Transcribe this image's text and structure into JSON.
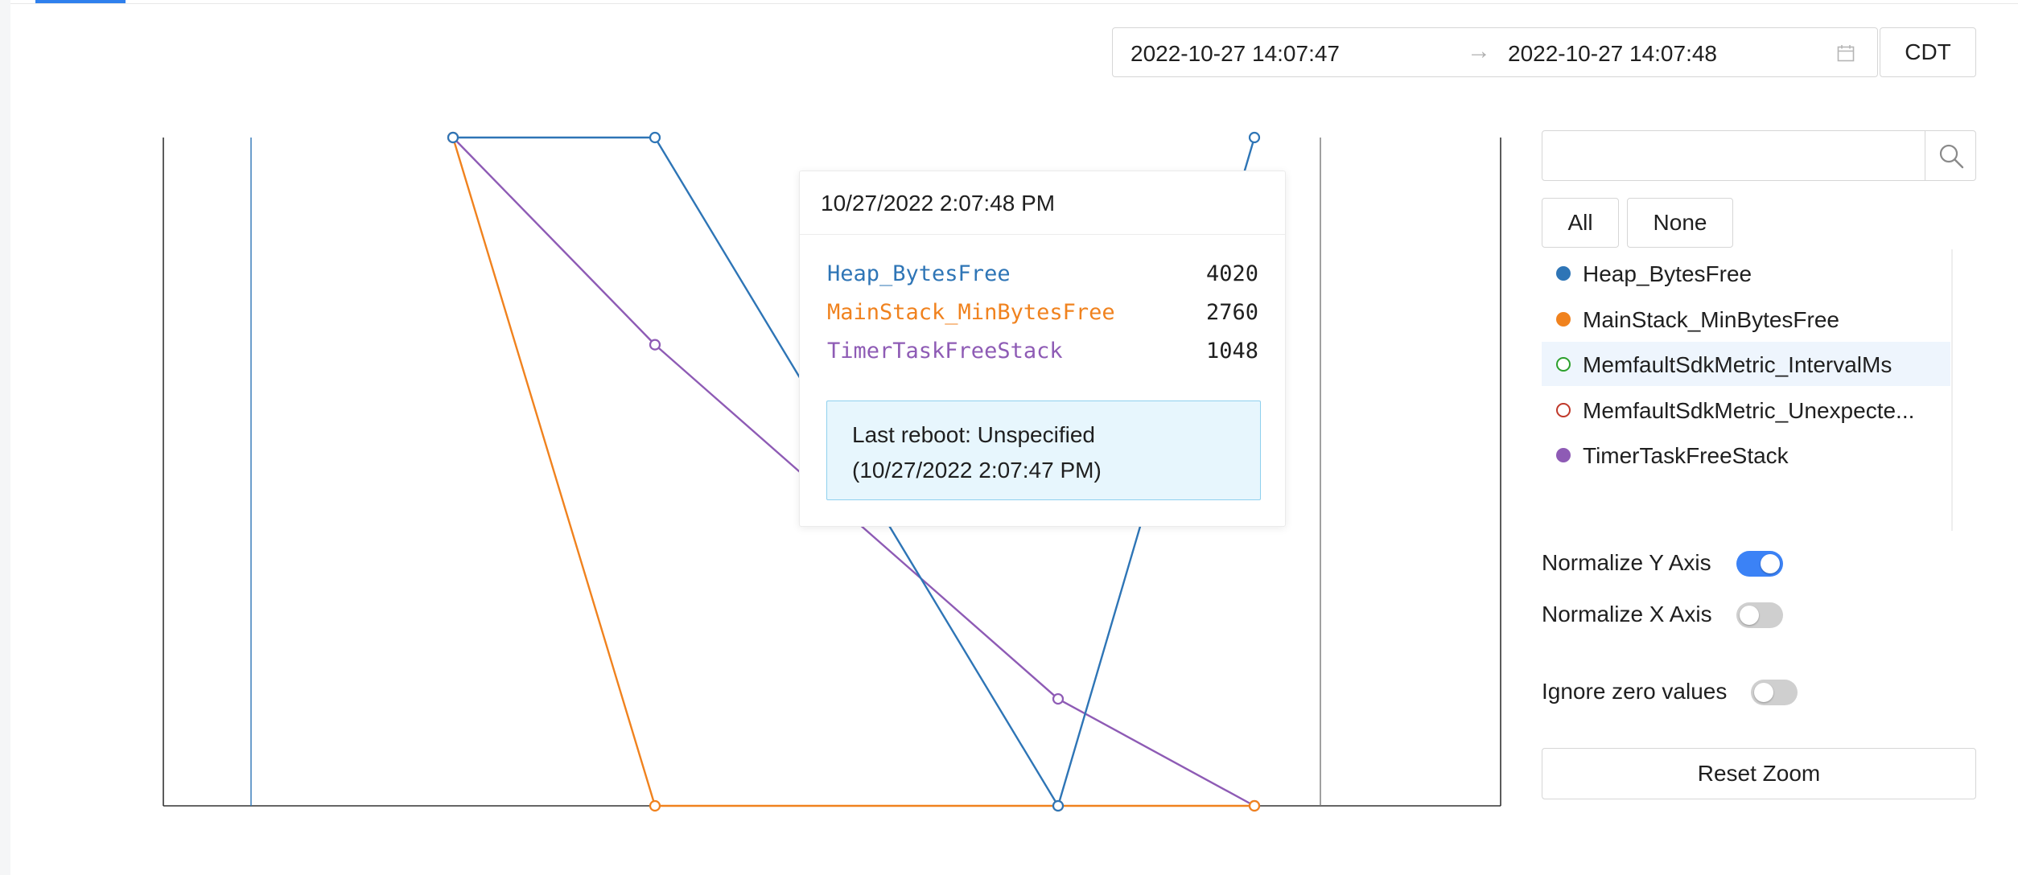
{
  "date_range": {
    "start": "2022-10-27 14:07:47",
    "end": "2022-10-27 14:07:48",
    "timezone": "CDT"
  },
  "chart_data": {
    "type": "line",
    "y_normalized": true,
    "series": [
      {
        "name": "Heap_BytesFree",
        "color": "#2e75b6",
        "values": [
          null,
          null,
          1.0,
          1.0,
          0.0,
          1.0
        ]
      },
      {
        "name": "MainStack_MinBytesFree",
        "color": "#f0821e",
        "values": [
          null,
          null,
          1.0,
          0.0,
          0.0,
          0.0
        ]
      },
      {
        "name": "TimerTaskFreeStack",
        "color": "#8e5bb5",
        "values": [
          null,
          null,
          1.0,
          0.69,
          0.16,
          0.0
        ]
      }
    ]
  },
  "tooltip": {
    "timestamp": "10/27/2022 2:07:48 PM",
    "rows": [
      {
        "name": "Heap_BytesFree",
        "value": "4020",
        "color": "#2e75b6"
      },
      {
        "name": "MainStack_MinBytesFree",
        "value": "2760",
        "color": "#f0821e"
      },
      {
        "name": "TimerTaskFreeStack",
        "value": "1048",
        "color": "#8e5bb5"
      }
    ],
    "reboot_line1": "Last reboot: Unspecified",
    "reboot_line2": "(10/27/2022 2:07:47 PM)"
  },
  "sidebar": {
    "search": {
      "placeholder": ""
    },
    "all_label": "All",
    "none_label": "None",
    "legend": [
      {
        "label": "Heap_BytesFree",
        "color": "#2e75b6",
        "enabled": true,
        "highlighted": false
      },
      {
        "label": "MainStack_MinBytesFree",
        "color": "#f0821e",
        "enabled": true,
        "highlighted": false
      },
      {
        "label": "MemfaultSdkMetric_IntervalMs",
        "color": "#2ca02c",
        "enabled": false,
        "highlighted": true
      },
      {
        "label": "MemfaultSdkMetric_Unexpecte...",
        "color": "#c0392b",
        "enabled": false,
        "highlighted": false
      },
      {
        "label": "TimerTaskFreeStack",
        "color": "#8e5bb5",
        "enabled": true,
        "highlighted": false
      }
    ],
    "normalize_y": {
      "label": "Normalize Y Axis",
      "on": true
    },
    "normalize_x": {
      "label": "Normalize X Axis",
      "on": false
    },
    "ignore_zero": {
      "label": "Ignore zero values",
      "on": false
    },
    "reset_label": "Reset Zoom"
  }
}
